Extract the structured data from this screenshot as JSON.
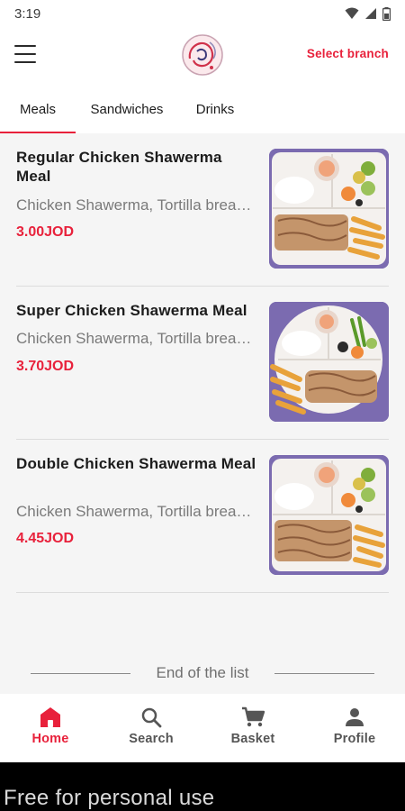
{
  "status_bar": {
    "time": "3:19"
  },
  "app_bar": {
    "select_branch_label": "Select branch"
  },
  "tabs": [
    {
      "label": "Meals",
      "active": true
    },
    {
      "label": "Sandwiches",
      "active": false
    },
    {
      "label": "Drinks",
      "active": false
    }
  ],
  "items": [
    {
      "title": "Regular Chicken Shawerma Meal",
      "description": "Chicken Shawerma, Tortilla bread, Fries, Pickles, Garlic sauce",
      "price": "3.00JOD"
    },
    {
      "title": "Super Chicken Shawerma Meal",
      "description": "Chicken Shawerma, Tortilla bread, Fries, Pickles, Garlic sauce",
      "price": "3.70JOD"
    },
    {
      "title": "Double Chicken Shawerma Meal",
      "description": "Chicken Shawerma, Tortilla bread, Fries, Pickles, Garlic sauce",
      "price": "4.45JOD"
    }
  ],
  "end_of_list": "End of the list",
  "bottom_nav": [
    {
      "label": "Home",
      "icon": "home-icon",
      "active": true
    },
    {
      "label": "Search",
      "icon": "search-icon",
      "active": false
    },
    {
      "label": "Basket",
      "icon": "cart-icon",
      "active": false
    },
    {
      "label": "Profile",
      "icon": "person-icon",
      "active": false
    }
  ],
  "watermark": "Free for personal use",
  "colors": {
    "accent": "#e8213b",
    "tray": "#7b6bb0"
  }
}
